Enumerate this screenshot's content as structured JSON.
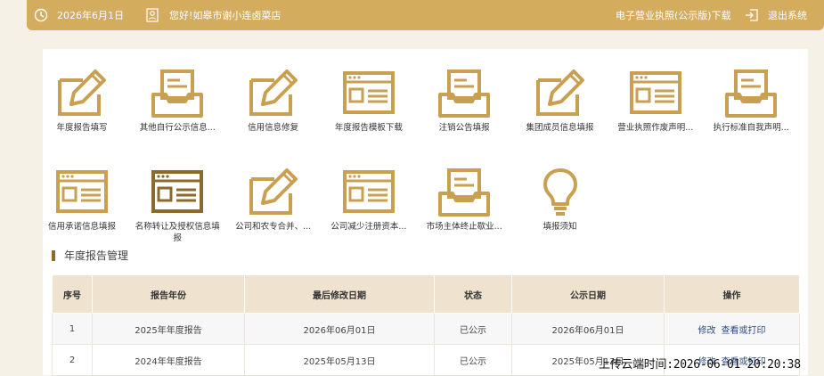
{
  "topbar": {
    "date": "2026年6月1日",
    "greeting": "您好!如皋市谢小连卤菜店",
    "license_link": "电子营业执照(公示版)下载",
    "logout": "退出系统",
    "accent": "#d4ac5e"
  },
  "tiles": [
    {
      "label": "年度报告填写",
      "icon": "pencil-icon"
    },
    {
      "label": "其他自行公示信息...",
      "icon": "inbox-tray-icon"
    },
    {
      "label": "信用信息修复",
      "icon": "pencil-icon"
    },
    {
      "label": "年度报告模板下载",
      "icon": "browser-window-icon"
    },
    {
      "label": "注销公告填报",
      "icon": "inbox-tray-icon"
    },
    {
      "label": "集团成员信息填报",
      "icon": "pencil-icon"
    },
    {
      "label": "营业执照作废声明...",
      "icon": "browser-window-icon"
    },
    {
      "label": "执行标准自我声明...",
      "icon": "inbox-tray-icon"
    },
    {
      "label": "信用承诺信息填报",
      "icon": "browser-window-icon"
    },
    {
      "label": "名称转让及授权信息填报",
      "icon": "browser-window-icon"
    },
    {
      "label": "公司和农专合并、...",
      "icon": "pencil-icon"
    },
    {
      "label": "公司减少注册资本...",
      "icon": "browser-window-icon"
    },
    {
      "label": "市场主体终止歇业...",
      "icon": "inbox-tray-icon"
    },
    {
      "label": "填报须知",
      "icon": "lightbulb-icon"
    }
  ],
  "section": {
    "title": "年度报告管理"
  },
  "table": {
    "headers": [
      "序号",
      "报告年份",
      "最后修改日期",
      "状态",
      "公示日期",
      "操作"
    ],
    "rows": [
      {
        "no": "1",
        "year": "2025年年度报告",
        "modified": "2026年06月01日",
        "status": "已公示",
        "published": "2026年06月01日",
        "op1": "修改",
        "op2": "查看或打印"
      },
      {
        "no": "2",
        "year": "2024年年度报告",
        "modified": "2025年05月13日",
        "status": "已公示",
        "published": "2025年05月13日",
        "op1": "修改",
        "op2": "查看或打印"
      }
    ]
  },
  "overlay": {
    "upload_time": "上传云端时间:2026-06-01 20:20:38"
  }
}
